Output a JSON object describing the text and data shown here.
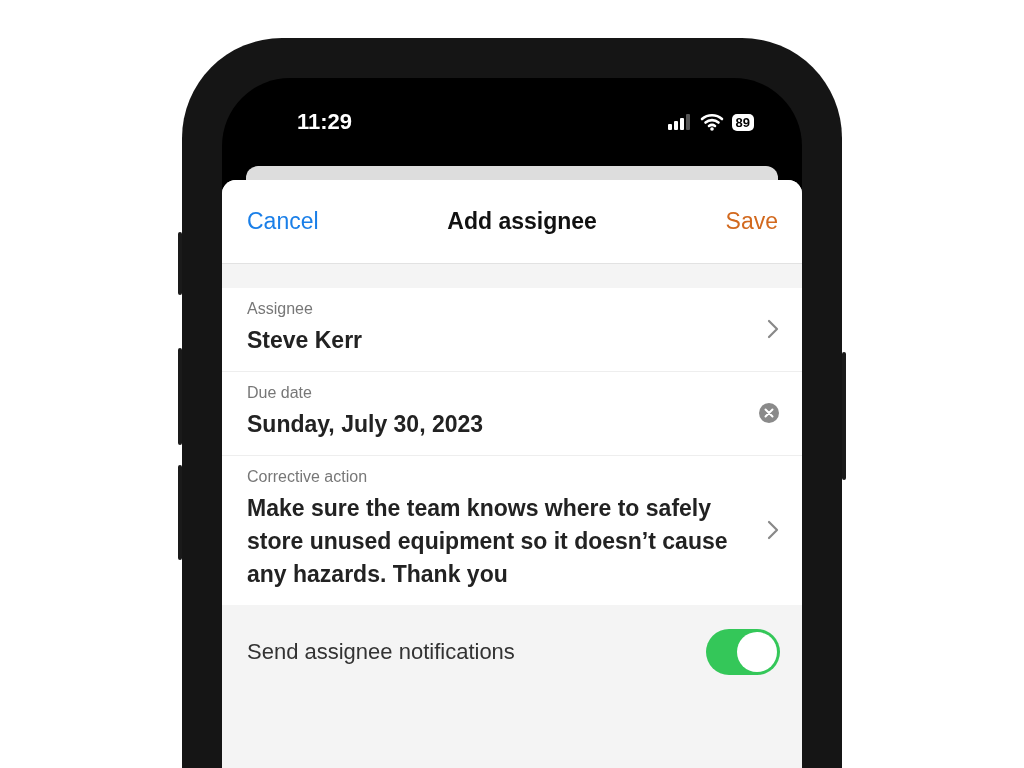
{
  "status_bar": {
    "time": "11:29",
    "battery": "89"
  },
  "header": {
    "cancel": "Cancel",
    "title": "Add assignee",
    "save": "Save"
  },
  "fields": [
    {
      "label": "Assignee",
      "value": "Steve Kerr",
      "kind": "chevron"
    },
    {
      "label": "Due date",
      "value": "Sunday, July 30, 2023",
      "kind": "clear"
    },
    {
      "label": "Corrective action",
      "value": "Make sure the team knows where to safely store unused equipment so it doesn’t cause any hazards. Thank you",
      "kind": "chevron"
    }
  ],
  "notifications": {
    "label": "Send assignee notifications",
    "on": true
  }
}
